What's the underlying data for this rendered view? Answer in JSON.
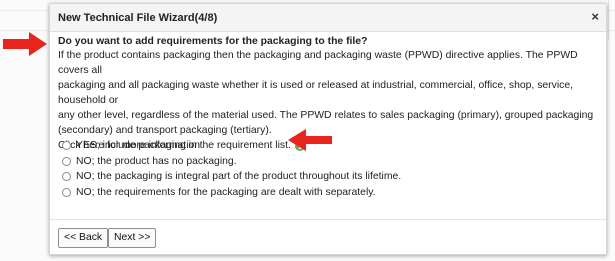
{
  "wizard": {
    "title": "New Technical File Wizard(4/8)",
    "close_label": "×",
    "question": "Do you want to add requirements for the packaging to the file?",
    "description_lines": [
      "If the product contains packaging then the packaging and packaging waste (PPWD) directive applies. The PPWD covers all",
      "packaging and all packaging waste whether it is used or released at industrial, commercial, office, shop, service, household or",
      "any other level, regardless of the material used. The PPWD relates to sales packaging (primary), grouped packaging",
      "(secondary) and transport packaging (tertiary)."
    ],
    "more_info": "Click here for more information",
    "options": [
      "YES; include packaging in the requirement list.",
      "NO; the product has no packaging.",
      "NO; the packaging is integral part of the product throughout its lifetime.",
      "NO; the requirements for the packaging are dealt with separately."
    ],
    "info_icon": "info-circle",
    "back_label": "<< Back",
    "next_label": "Next >>"
  },
  "colors": {
    "annotation_arrow": "#e8251d",
    "info_icon": "#6aa84f"
  }
}
